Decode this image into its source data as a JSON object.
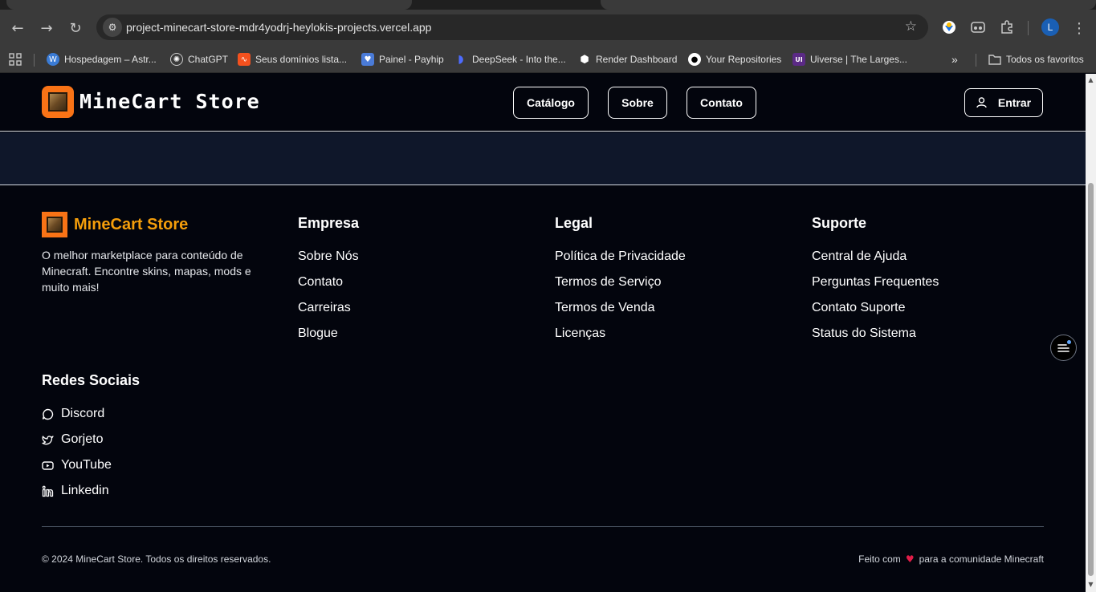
{
  "browser": {
    "url": "project-minecart-store-mdr4yodrj-heylokis-projects.vercel.app",
    "profile_initial": "L",
    "bookmarks": [
      {
        "label": "Hospedagem – Astr...",
        "icon": "wordpress-icon",
        "color": "#3a7bd5"
      },
      {
        "label": "ChatGPT",
        "icon": "chatgpt-icon",
        "color": "#3a3a3a"
      },
      {
        "label": "Seus domínios lista...",
        "icon": "domain-icon",
        "color": "#f4511e"
      },
      {
        "label": "Painel - Payhip",
        "icon": "payhip-icon",
        "color": "#4a7bd8"
      },
      {
        "label": "DeepSeek - Into the...",
        "icon": "deepseek-icon",
        "color": "#4d6bfe"
      },
      {
        "label": "Render Dashboard",
        "icon": "render-icon",
        "color": "#3a3a3a"
      },
      {
        "label": "Your Repositories",
        "icon": "github-icon",
        "color": "#3a3a3a"
      },
      {
        "label": "Uiverse | The Larges...",
        "icon": "uiverse-icon",
        "color": "#5b2a86"
      }
    ],
    "all_bookmarks": "Todos os favoritos"
  },
  "header": {
    "brand": "MineCart Store",
    "nav": [
      "Catálogo",
      "Sobre",
      "Contato"
    ],
    "login": "Entrar"
  },
  "footer": {
    "brand": "MineCart Store",
    "description": "O melhor marketplace para conteúdo de Minecraft. Encontre skins, mapas, mods e muito mais!",
    "columns": [
      {
        "title": "Empresa",
        "links": [
          "Sobre Nós",
          "Contato",
          "Carreiras",
          "Blogue"
        ]
      },
      {
        "title": "Legal",
        "links": [
          "Política de Privacidade",
          "Termos de Serviço",
          "Termos de Venda",
          "Licenças"
        ]
      },
      {
        "title": "Suporte",
        "links": [
          "Central de Ajuda",
          "Perguntas Frequentes",
          "Contato Suporte",
          "Status do Sistema"
        ]
      }
    ],
    "social_title": "Redes Sociais",
    "social": [
      {
        "label": "Discord",
        "icon": "discord-icon"
      },
      {
        "label": "Gorjeto",
        "icon": "twitter-icon"
      },
      {
        "label": "YouTube",
        "icon": "youtube-icon"
      },
      {
        "label": "Linkedin",
        "icon": "linkedin-icon"
      }
    ],
    "copyright": "© 2024 MineCart Store. Todos os direitos reservados.",
    "made_with_prefix": "Feito com",
    "made_with_suffix": "para a comunidade Minecraft"
  },
  "colors": {
    "accent": "#f97316",
    "brand_text": "#f59e0b",
    "background": "#03050d",
    "band": "#0f172a"
  }
}
